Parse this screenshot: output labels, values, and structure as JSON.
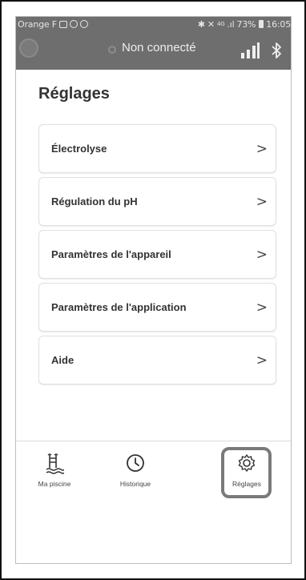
{
  "status_bar": {
    "carrier": "Orange F",
    "network": "4G",
    "battery": "73%",
    "time": "16:05"
  },
  "header": {
    "connection_status": "Non connecté",
    "icons": [
      "app-logo-icon",
      "signal-bars-icon",
      "bluetooth-icon"
    ]
  },
  "page": {
    "title": "Réglages"
  },
  "menu": {
    "items": [
      {
        "label": "Électrolyse",
        "chevron": ">"
      },
      {
        "label": "Régulation du pH",
        "chevron": ">"
      },
      {
        "label": "Paramètres de l'appareil",
        "chevron": ">"
      },
      {
        "label": "Paramètres de l'application",
        "chevron": ">"
      },
      {
        "label": "Aide",
        "chevron": ">"
      }
    ]
  },
  "bottom_nav": {
    "items": [
      {
        "label": "Ma piscine",
        "icon": "pool-ladder-icon",
        "active": false
      },
      {
        "label": "Historique",
        "icon": "clock-icon",
        "active": false
      },
      {
        "label": "Réglages",
        "icon": "gear-icon",
        "active": true
      }
    ]
  },
  "colors": {
    "header_bg": "#6e6e6e",
    "active_highlight": "#7a7a7a"
  }
}
